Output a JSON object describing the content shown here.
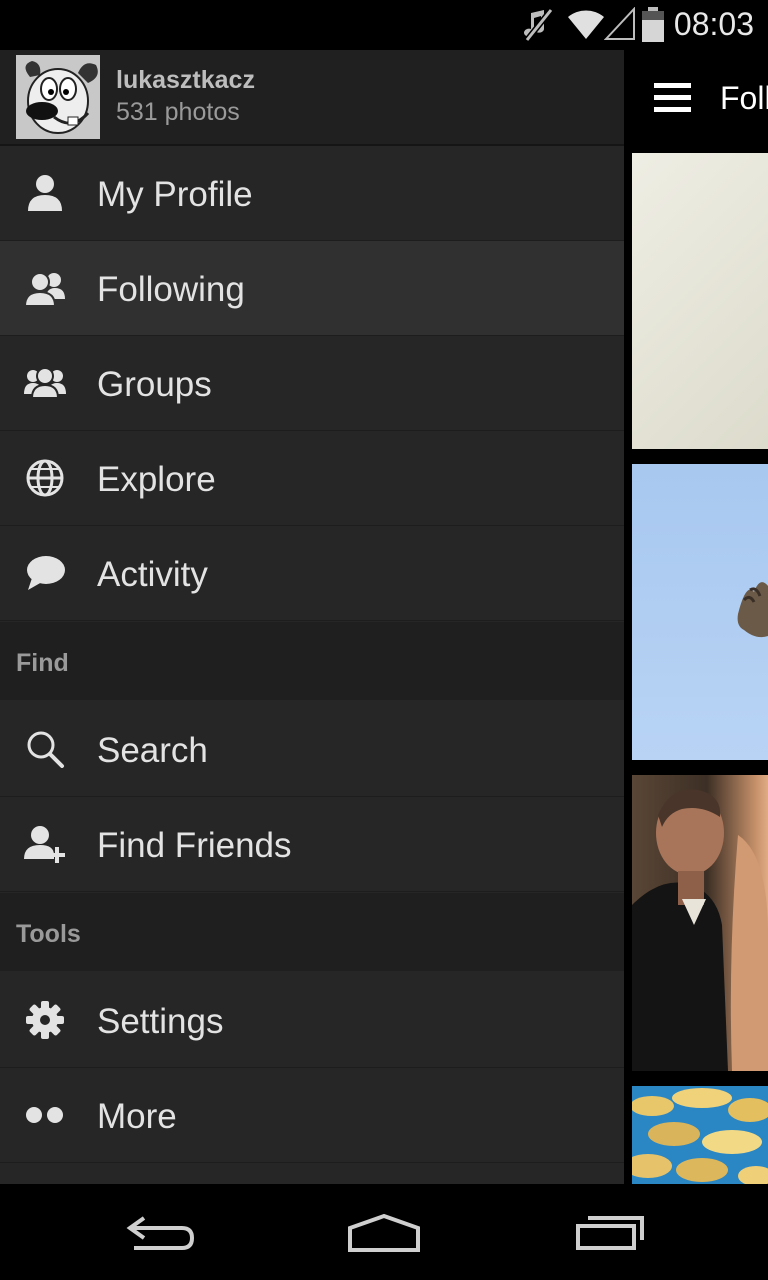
{
  "status_bar": {
    "time": "08:03",
    "icons": [
      "mute-icon",
      "wifi-icon",
      "signal-icon",
      "battery-icon"
    ]
  },
  "drawer": {
    "user": {
      "name": "lukasztkacz",
      "photos": "531 photos"
    },
    "items": [
      {
        "label": "My Profile",
        "icon": "person-icon",
        "active": false
      },
      {
        "label": "Following",
        "icon": "people-icon",
        "active": true
      },
      {
        "label": "Groups",
        "icon": "group-icon",
        "active": false
      },
      {
        "label": "Explore",
        "icon": "globe-icon",
        "active": false
      },
      {
        "label": "Activity",
        "icon": "chat-bubble-icon",
        "active": false
      }
    ],
    "sections": [
      {
        "title": "Find",
        "items": [
          {
            "label": "Search",
            "icon": "search-icon"
          },
          {
            "label": "Find Friends",
            "icon": "add-person-icon"
          }
        ]
      },
      {
        "title": "Tools",
        "items": [
          {
            "label": "Settings",
            "icon": "gear-icon"
          },
          {
            "label": "More",
            "icon": "more-icon"
          }
        ]
      }
    ]
  },
  "content": {
    "title": "Foll"
  },
  "nav_bar": {
    "buttons": [
      "back-icon",
      "home-icon",
      "recents-icon"
    ]
  }
}
